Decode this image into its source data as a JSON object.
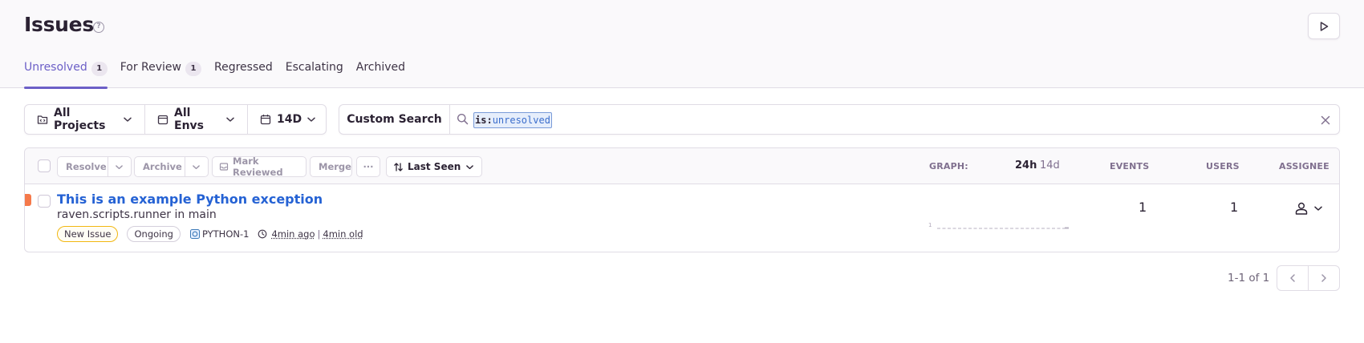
{
  "header": {
    "title": "Issues",
    "help_icon": "question-circle-icon",
    "play_icon": "play-icon"
  },
  "tabs": [
    {
      "label": "Unresolved",
      "count": "1",
      "active": true
    },
    {
      "label": "For Review",
      "count": "1",
      "active": false
    },
    {
      "label": "Regressed",
      "active": false
    },
    {
      "label": "Escalating",
      "active": false
    },
    {
      "label": "Archived",
      "active": false
    }
  ],
  "filters": {
    "projects": "All Projects",
    "envs": "All Envs",
    "period": "14D"
  },
  "search": {
    "custom_search_label": "Custom Search",
    "token_key": "is:",
    "token_value": "unresolved"
  },
  "toolbar": {
    "resolve_label": "Resolve",
    "archive_label": "Archive",
    "mark_reviewed_label": "Mark Reviewed",
    "merge_label": "Merge",
    "more_label": "···",
    "sort_label": "Last Seen"
  },
  "columns": {
    "graph": "GRAPH:",
    "period_24h": "24h",
    "period_14d": "14d",
    "events": "EVENTS",
    "users": "USERS",
    "assignee": "ASSIGNEE"
  },
  "issues": [
    {
      "title": "This is an example Python exception",
      "culprit": "raven.scripts.runner in main",
      "badge_new": "New Issue",
      "badge_status": "Ongoing",
      "short_id": "PYTHON-1",
      "last_seen": "4min ago",
      "first_seen": "4min old",
      "graph_axis_label": "1",
      "events": "1",
      "users": "1",
      "level_color": "#f5794a"
    }
  ],
  "pagination": {
    "text": "1-1 of 1"
  },
  "colors": {
    "accent": "#6c5fc7",
    "link": "#2562d4",
    "new_issue_border": "#f2b712"
  }
}
